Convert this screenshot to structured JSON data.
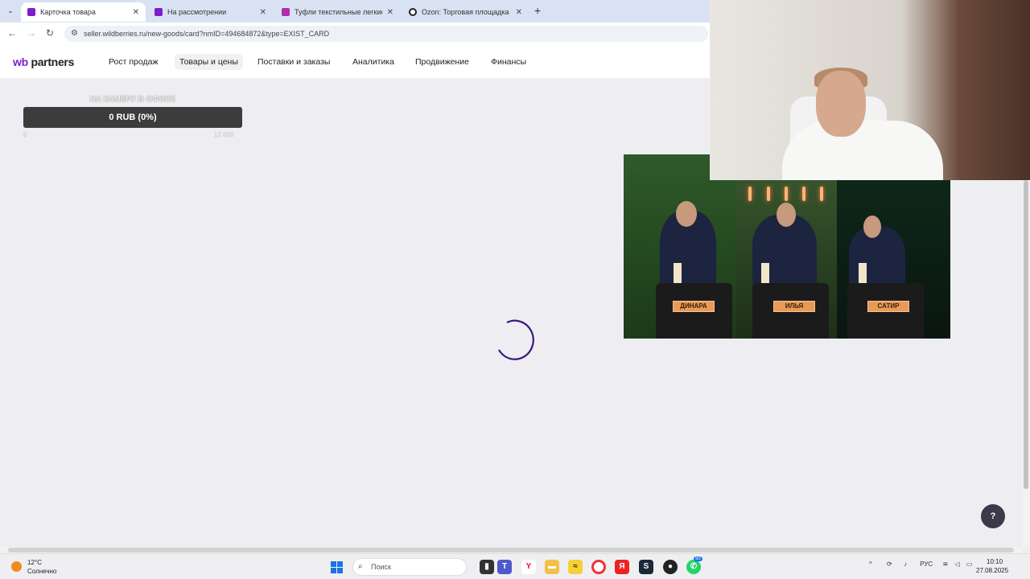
{
  "browser": {
    "tabs": [
      {
        "title": "Карточка товара",
        "active": true
      },
      {
        "title": "На рассмотрении",
        "active": false
      },
      {
        "title": "Туфли текстильные легкие в ...",
        "active": false
      },
      {
        "title": "Ozon: Торговая площадка",
        "active": false
      }
    ],
    "url": "seller.wildberries.ru/new-goods/card?nmID=494684872&type=EXIST_CARD"
  },
  "site": {
    "logo_wb": "wb",
    "logo_partners": "partners",
    "nav": [
      {
        "label": "Рост продаж"
      },
      {
        "label": "Товары и цены",
        "active": true
      },
      {
        "label": "Поставки и заказы"
      },
      {
        "label": "Аналитика"
      },
      {
        "label": "Продвижение"
      },
      {
        "label": "Финансы"
      }
    ]
  },
  "donation": {
    "title": "НА КАМЕРУ В ОФИСЕ",
    "amount": "0 RUB (0%)",
    "progress": 0,
    "min": "0",
    "max": "12 000"
  },
  "stream": {
    "name_plates": [
      "ДИНАРА",
      "ИЛЬЯ",
      "САТИР"
    ]
  },
  "help": {
    "label": "?"
  },
  "taskbar": {
    "weather_temp": "12°C",
    "weather_desc": "Солнечно",
    "search_placeholder": "Поиск",
    "lang": "РУС",
    "time": "10:10",
    "date": "27.08.2025",
    "badge": "50"
  },
  "colors": {
    "accent": "#7e1ec9",
    "spinner": "#3b1a80",
    "windows_blue": "#1a73e8"
  }
}
